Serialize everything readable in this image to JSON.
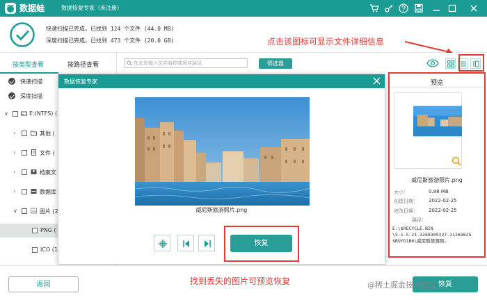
{
  "app": {
    "name": "数据蛙",
    "subtitle": "数据恢复专家（未注册）"
  },
  "status": {
    "quick_scan": "快速扫描已完成，已找到 124 个文件 (44.0 MB)",
    "deep_scan": "深度扫描已完成，已找到 473 个文件 (20.0 GB)"
  },
  "annotations": {
    "top": "点击该图标可显示文件详细信息",
    "bottom": "找到丢失的图片可预览恢复"
  },
  "sidebar": {
    "tabs": [
      "按类型查看",
      "按路径查看"
    ],
    "scan_modes": [
      "快速扫描",
      "深度扫描"
    ],
    "tree": [
      {
        "label": "E:(NTFS) (",
        "icon": "drive-icon",
        "chev": "∨"
      },
      {
        "label": "其他 (",
        "icon": "folder-icon",
        "chev": "›"
      },
      {
        "label": "文件 (",
        "icon": "document-icon",
        "chev": "›"
      },
      {
        "label": "档案文",
        "icon": "archive-icon",
        "chev": "›"
      },
      {
        "label": "数据库",
        "icon": "database-icon",
        "chev": "›"
      },
      {
        "label": "图片 (2",
        "icon": "image-icon",
        "chev": "∨"
      },
      {
        "label": "PNG (",
        "icon": "",
        "chev": ""
      },
      {
        "label": "ICO (1",
        "icon": "",
        "chev": ""
      }
    ]
  },
  "toolbar": {
    "search_placeholder": "在此处输入文件名称或保存路径",
    "filter_label": "筛选器"
  },
  "preview": {
    "title": "预览",
    "filename": "威尼斯旅游照片.png",
    "size_label": "大小：",
    "size_value": "0.98 MB",
    "created_label": "创建日期：",
    "created_value": "2022-02-25",
    "modified_label": "修改日期：",
    "modified_value": "2022-02-25",
    "path_label": "路径：",
    "path_lines": [
      "E:\\$RECYCLE.BIN",
      "\\S-1-5-21-3268309327-21269625",
      "$RUYO1B6\\威尼斯旅游照…"
    ]
  },
  "dialog": {
    "title": "数据恢复专家",
    "filename": "威尼斯旅游照片.png",
    "recover_label": "恢复"
  },
  "bottom": {
    "back_label": "返回",
    "recover_label": "恢复",
    "watermark": "@稀土掘金技术社区"
  },
  "colors": {
    "brand": "#1a9b93",
    "button": "#2b9d97",
    "annotation": "#e53935"
  }
}
